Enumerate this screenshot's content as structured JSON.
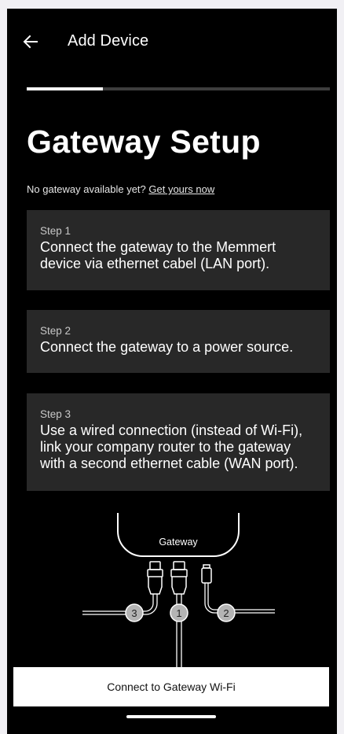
{
  "header": {
    "title": "Add Device",
    "back_icon": "arrow-left-icon"
  },
  "progress": {
    "fraction": 0.25
  },
  "page": {
    "title": "Gateway Setup",
    "no_gateway_text": "No gateway available yet?",
    "no_gateway_link": "Get yours now"
  },
  "steps": [
    {
      "label": "Step 1",
      "text": "Connect the gateway to the Memmert device via ethernet cabel (LAN port)."
    },
    {
      "label": "Step 2",
      "text": "Connect the gateway to a power source."
    },
    {
      "label": "Step 3",
      "text": "Use a wired connection (instead of Wi-Fi), link your company router to the gateway with a second ethernet cable (WAN port)."
    }
  ],
  "illustration": {
    "gateway_label": "Gateway",
    "port_numbers": [
      "3",
      "1",
      "2"
    ]
  },
  "footer": {
    "connect_button": "Connect to Gateway Wi-Fi"
  },
  "colors": {
    "background": "#000000",
    "card": "#282828",
    "progress_track": "#3d3d3d",
    "badge": "#b4b4b4"
  }
}
